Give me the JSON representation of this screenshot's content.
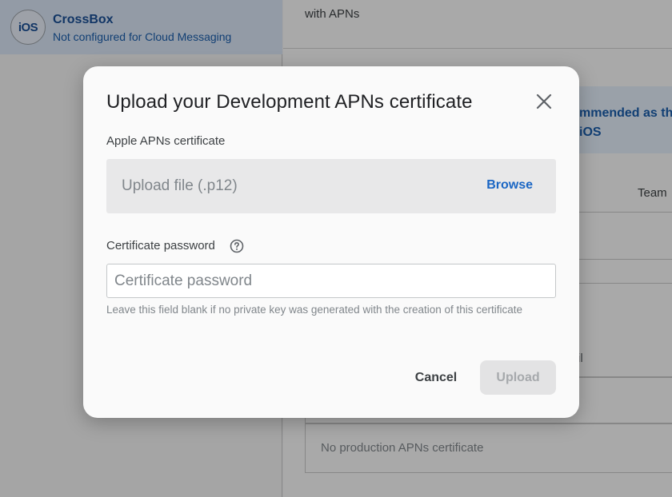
{
  "sidebar": {
    "app": {
      "platform_badge": "iOS",
      "name": "CrossBox",
      "status": "Not configured for Cloud Messaging"
    }
  },
  "background": {
    "apns_text": "with APNs",
    "banner_text_line1": "mmended as th",
    "banner_text_line2": "iOS",
    "team_label": "Team",
    "partial_text": "il",
    "production_cert_text": "No production APNs certificate"
  },
  "dialog": {
    "title": "Upload your Development APNs certificate",
    "certificate_label": "Apple APNs certificate",
    "upload_placeholder": "Upload file (.p12)",
    "browse_label": "Browse",
    "password_label": "Certificate password",
    "password_placeholder": "Certificate password",
    "password_value": "",
    "hint": "Leave this field blank if no private key was generated with the creation of this certificate",
    "cancel_label": "Cancel",
    "upload_label": "Upload"
  },
  "colors": {
    "accent": "#1a66c4",
    "sidebar_highlight": "#d9e5f5",
    "disabled_button": "#e3e3e4"
  },
  "icons": {
    "close": "close-icon",
    "help": "help-circle-icon"
  }
}
